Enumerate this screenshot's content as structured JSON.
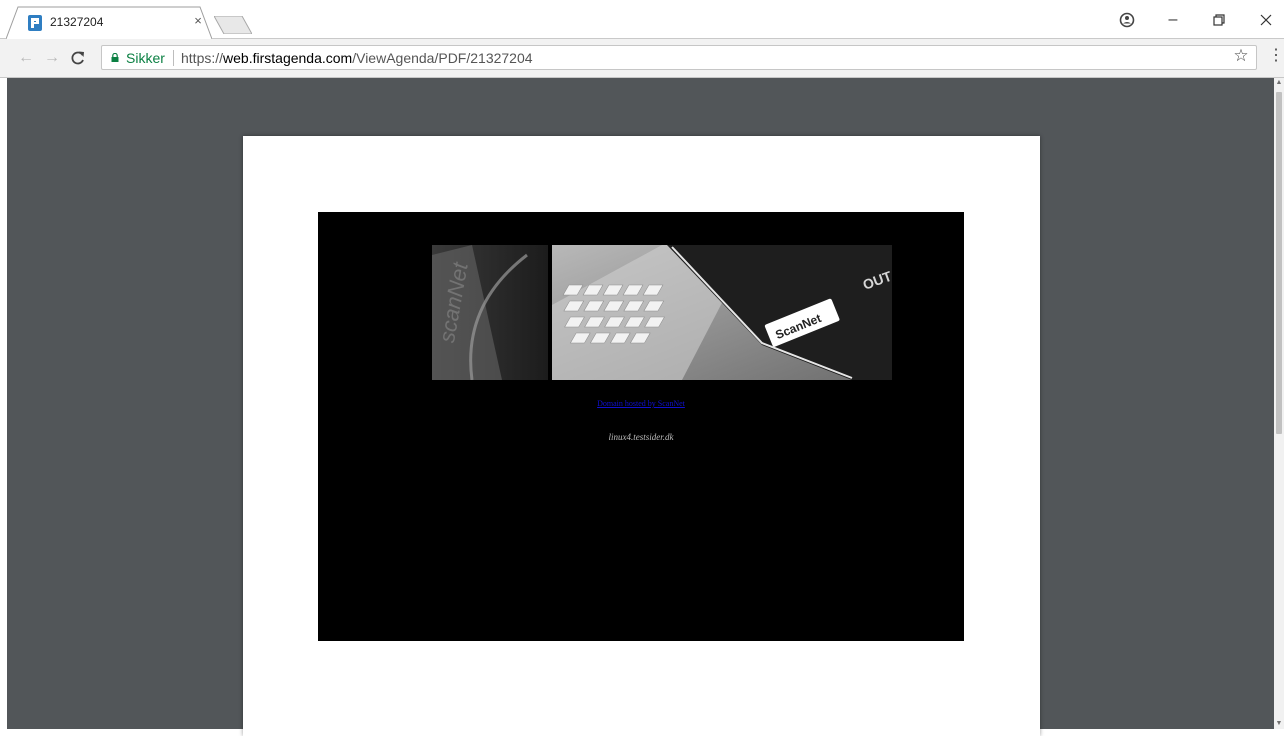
{
  "browser": {
    "tab": {
      "title": "21327204",
      "close_glyph": "×"
    },
    "window_controls": {
      "account_icon": "account-icon",
      "minimize": "–",
      "restore": "❐",
      "close": "✕"
    },
    "nav": {
      "back": "←",
      "forward": "→",
      "reload": "C"
    },
    "omnibox": {
      "secure_label": "Sikker",
      "url_scheme": "https://",
      "url_host": "web.firstagenda.com",
      "url_path": "/ViewAgenda/PDF/21327204"
    },
    "bookmark_glyph": "☆",
    "menu_glyph": "⋮"
  },
  "document": {
    "banner_logo_text": "ScanNet",
    "banner_sign_text": "OUT",
    "link_text": "Domain hosted by ScanNet",
    "hostname_text": "linux4.testsider.dk"
  },
  "colors": {
    "viewer_background": "#525659",
    "secure_green": "#0b8043",
    "link_blue": "#1010d0"
  }
}
